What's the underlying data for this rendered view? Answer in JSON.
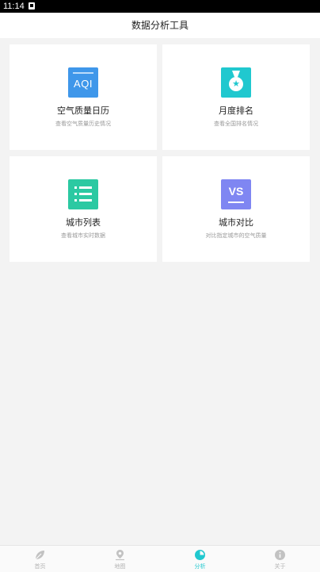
{
  "status_bar": {
    "time": "11:14"
  },
  "header": {
    "title": "数据分析工具"
  },
  "tiles": [
    {
      "title": "空气质量日历",
      "desc": "查看空气质量历史情况",
      "icon": "aqi-calendar-icon",
      "icon_text": "AQI",
      "color": "#3f97ea"
    },
    {
      "title": "月度排名",
      "desc": "查看全国排名情况",
      "icon": "medal-icon",
      "color": "#20c8cf"
    },
    {
      "title": "城市列表",
      "desc": "查看城市实时数据",
      "icon": "list-icon",
      "color": "#2bc9a2"
    },
    {
      "title": "城市对比",
      "desc": "对比指定城市的空气质量",
      "icon": "vs-icon",
      "icon_text": "VS",
      "color": "#7f86f2"
    }
  ],
  "nav": [
    {
      "label": "首页",
      "icon": "leaf-icon"
    },
    {
      "label": "地图",
      "icon": "map-pin-icon"
    },
    {
      "label": "分析",
      "icon": "pie-chart-icon",
      "active": true
    },
    {
      "label": "关于",
      "icon": "info-icon"
    }
  ],
  "colors": {
    "accent": "#20c8cf",
    "inactive": "#b3b3b3"
  }
}
